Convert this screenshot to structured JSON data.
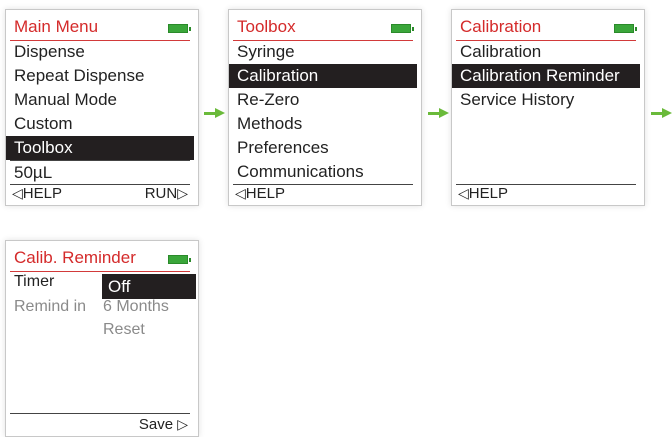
{
  "screens": {
    "main_menu": {
      "title": "Main Menu",
      "items": [
        "Dispense",
        "Repeat Dispense",
        "Manual Mode",
        "Custom",
        "Toolbox"
      ],
      "selected": "Toolbox",
      "volume": "50µL",
      "left_softkey": "HELP",
      "right_softkey": "RUN"
    },
    "toolbox": {
      "title": "Toolbox",
      "items": [
        "Syringe",
        "Calibration",
        "Re-Zero",
        "Methods",
        "Preferences",
        "Communications"
      ],
      "selected": "Calibration",
      "left_softkey": "HELP"
    },
    "calibration": {
      "title": "Calibration",
      "items": [
        "Calibration",
        "Calibration Reminder",
        "Service History"
      ],
      "selected": "Calibration Reminder",
      "left_softkey": "HELP"
    },
    "calib_reminder": {
      "title": "Calib. Reminder",
      "timer_label": "Timer",
      "timer_value": "Off",
      "remind_label": "Remind in",
      "remind_value": "6 Months",
      "reset_label": "Reset",
      "right_softkey": "Save"
    }
  },
  "icons": {
    "battery": "battery-icon",
    "left_triangle": "◁",
    "right_triangle": "▷",
    "flow_arrow": "arrow-right-icon"
  },
  "colors": {
    "title_red": "#d42a2a",
    "selection_black": "#231f20",
    "arrow_green": "#6aba3a",
    "battery_green": "#3aa63a",
    "muted_gray": "#8a8a8a"
  }
}
